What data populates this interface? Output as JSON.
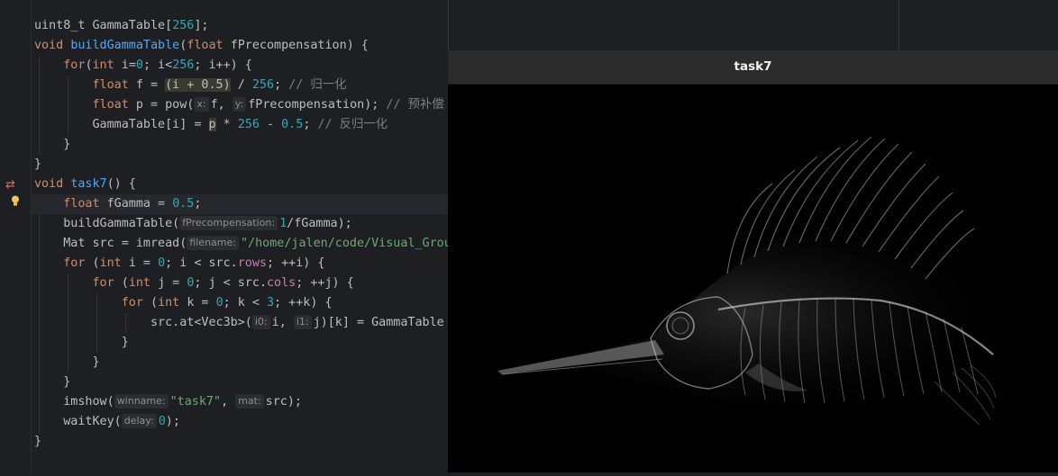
{
  "window": {
    "title": "task7"
  },
  "code": {
    "l1": {
      "type": "uint8_t ",
      "name": "GammaTable",
      "b1": "[",
      "n": "256",
      "b2": "];"
    },
    "l2": {
      "kw": "void ",
      "fn": "buildGammaTable",
      "p1": "(",
      "kw2": "float ",
      "param": "fPrecompensation",
      "p2": ") {"
    },
    "l3": {
      "kw": "for",
      "p1": "(",
      "kw2": "int ",
      "v": "i",
      "p2": "=",
      "n0": "0",
      "p3": "; i<",
      "n256": "256",
      "p4": "; i++) {"
    },
    "l4": {
      "kw": "float ",
      "t1": "f = ",
      "hl": "(i + 0.5)",
      "t2": " / ",
      "n": "256",
      "t3": "; ",
      "cm": "// 归一化"
    },
    "l5": {
      "kw": "float ",
      "t1": "p = pow(",
      "h1": "x:",
      "t2": "f, ",
      "h2": "y:",
      "t3": "fPrecompensation); ",
      "cm": "// 预补偿"
    },
    "l6": {
      "t1": "GammaTable[i] = ",
      "hl": "p",
      "t2": " * ",
      "n1": "256",
      "t3": " - ",
      "n2": "0.5",
      "t4": "; ",
      "cm": "// 反归一化"
    },
    "l7": "}",
    "l8": "}",
    "l9": {
      "kw": "void ",
      "fn": "task7",
      "t": "() {"
    },
    "l10": {
      "kw": "float ",
      "t1": "fGamma = ",
      "n": "0.5",
      "t2": ";"
    },
    "l11": {
      "t1": "buildGammaTable(",
      "h": "fPrecompensation:",
      "n": "1",
      "t2": "/fGamma);"
    },
    "l12": {
      "t1": "Mat src = imread(",
      "h": "filename:",
      "s": "\"/home/jalen/code/Visual_Grou"
    },
    "l13": {
      "kw": "for",
      "t1": " (",
      "kw2": "int ",
      "t2": "i = ",
      "n": "0",
      "t3": "; i < src.",
      "f": "rows",
      "t4": "; ++i) {"
    },
    "l14": {
      "kw": "for",
      "t1": " (",
      "kw2": "int ",
      "t2": "j = ",
      "n": "0",
      "t3": "; j < src.",
      "f": "cols",
      "t4": "; ++j) {"
    },
    "l15": {
      "kw": "for",
      "t1": " (",
      "kw2": "int ",
      "t2": "k = ",
      "n": "0",
      "t3": "; k < ",
      "n2": "3",
      "t4": "; ++k) {"
    },
    "l16": {
      "t1": "src.at<Vec3b>(",
      "h1": "i0:",
      "t2": "i, ",
      "h2": "i1:",
      "t3": "j)[k] = GammaTable"
    },
    "l17": "}",
    "l18": "}",
    "l19": "}",
    "l20": {
      "t1": "imshow(",
      "h1": "winname:",
      "s": "\"task7\"",
      "t2": ", ",
      "h2": "mat:",
      "t3": "src);"
    },
    "l21": {
      "t1": "waitKey(",
      "h": "delay:",
      "n": "0",
      "t2": ");"
    },
    "l22": "}"
  }
}
